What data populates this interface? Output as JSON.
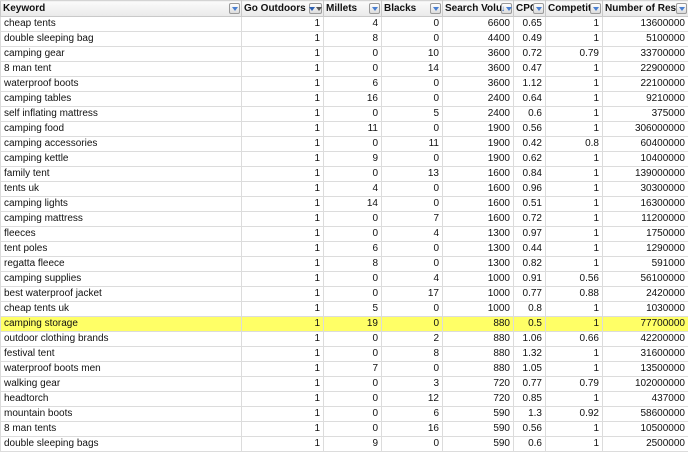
{
  "headers": [
    {
      "label": "Keyword",
      "filter": "arrow"
    },
    {
      "label": "Go Outdoors",
      "filter": "funnel"
    },
    {
      "label": "Millets",
      "filter": "arrow"
    },
    {
      "label": "Blacks",
      "filter": "arrow"
    },
    {
      "label": "Search Volume",
      "filter": "sort-desc"
    },
    {
      "label": "CPC",
      "filter": "arrow"
    },
    {
      "label": "Competition",
      "filter": "arrow"
    },
    {
      "label": "Number of Results",
      "filter": "arrow"
    }
  ],
  "rows": [
    [
      "cheap tents",
      "1",
      "4",
      "0",
      "6600",
      "0.65",
      "1",
      "13600000"
    ],
    [
      "double sleeping bag",
      "1",
      "8",
      "0",
      "4400",
      "0.49",
      "1",
      "5100000"
    ],
    [
      "camping gear",
      "1",
      "0",
      "10",
      "3600",
      "0.72",
      "0.79",
      "33700000"
    ],
    [
      "8 man tent",
      "1",
      "0",
      "14",
      "3600",
      "0.47",
      "1",
      "22900000"
    ],
    [
      "waterproof boots",
      "1",
      "6",
      "0",
      "3600",
      "1.12",
      "1",
      "22100000"
    ],
    [
      "camping tables",
      "1",
      "16",
      "0",
      "2400",
      "0.64",
      "1",
      "9210000"
    ],
    [
      "self inflating mattress",
      "1",
      "0",
      "5",
      "2400",
      "0.6",
      "1",
      "375000"
    ],
    [
      "camping food",
      "1",
      "11",
      "0",
      "1900",
      "0.56",
      "1",
      "306000000"
    ],
    [
      "camping accessories",
      "1",
      "0",
      "11",
      "1900",
      "0.42",
      "0.8",
      "60400000"
    ],
    [
      "camping kettle",
      "1",
      "9",
      "0",
      "1900",
      "0.62",
      "1",
      "10400000"
    ],
    [
      "family tent",
      "1",
      "0",
      "13",
      "1600",
      "0.84",
      "1",
      "139000000"
    ],
    [
      "tents uk",
      "1",
      "4",
      "0",
      "1600",
      "0.96",
      "1",
      "30300000"
    ],
    [
      "camping lights",
      "1",
      "14",
      "0",
      "1600",
      "0.51",
      "1",
      "16300000"
    ],
    [
      "camping mattress",
      "1",
      "0",
      "7",
      "1600",
      "0.72",
      "1",
      "11200000"
    ],
    [
      "fleeces",
      "1",
      "0",
      "4",
      "1300",
      "0.97",
      "1",
      "1750000"
    ],
    [
      "tent poles",
      "1",
      "6",
      "0",
      "1300",
      "0.44",
      "1",
      "1290000"
    ],
    [
      "regatta fleece",
      "1",
      "8",
      "0",
      "1300",
      "0.82",
      "1",
      "591000"
    ],
    [
      "camping supplies",
      "1",
      "0",
      "4",
      "1000",
      "0.91",
      "0.56",
      "56100000"
    ],
    [
      "best waterproof jacket",
      "1",
      "0",
      "17",
      "1000",
      "0.77",
      "0.88",
      "2420000"
    ],
    [
      "cheap tents uk",
      "1",
      "5",
      "0",
      "1000",
      "0.8",
      "1",
      "1030000"
    ],
    [
      "camping storage",
      "1",
      "19",
      "0",
      "880",
      "0.5",
      "1",
      "77700000"
    ],
    [
      "outdoor clothing brands",
      "1",
      "0",
      "2",
      "880",
      "1.06",
      "0.66",
      "42200000"
    ],
    [
      "festival tent",
      "1",
      "0",
      "8",
      "880",
      "1.32",
      "1",
      "31600000"
    ],
    [
      "waterproof boots men",
      "1",
      "7",
      "0",
      "880",
      "1.05",
      "1",
      "13500000"
    ],
    [
      "walking gear",
      "1",
      "0",
      "3",
      "720",
      "0.77",
      "0.79",
      "102000000"
    ],
    [
      "headtorch",
      "1",
      "0",
      "12",
      "720",
      "0.85",
      "1",
      "437000"
    ],
    [
      "mountain boots",
      "1",
      "0",
      "6",
      "590",
      "1.3",
      "0.92",
      "58600000"
    ],
    [
      "8 man tents",
      "1",
      "0",
      "16",
      "590",
      "0.56",
      "1",
      "10500000"
    ],
    [
      "double sleeping bags",
      "1",
      "9",
      "0",
      "590",
      "0.6",
      "1",
      "2500000"
    ]
  ],
  "highlighted_row": 20,
  "colors": {
    "highlight": "#ffff66",
    "filter_accent": "#2d5fb0"
  }
}
